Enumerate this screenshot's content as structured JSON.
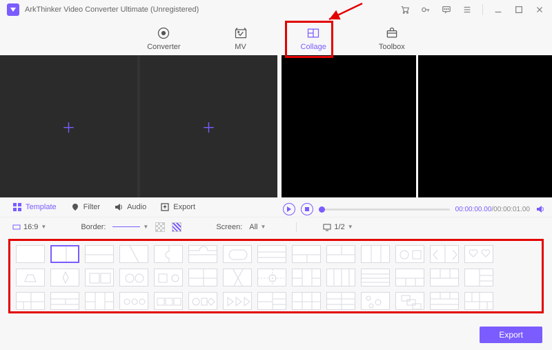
{
  "app": {
    "title": "ArkThinker Video Converter Ultimate (Unregistered)"
  },
  "nav": {
    "items": [
      {
        "label": "Converter"
      },
      {
        "label": "MV"
      },
      {
        "label": "Collage"
      },
      {
        "label": "Toolbox"
      }
    ],
    "active_index": 2
  },
  "tabs": {
    "items": [
      {
        "label": "Template"
      },
      {
        "label": "Filter"
      },
      {
        "label": "Audio"
      },
      {
        "label": "Export"
      }
    ],
    "active_index": 0
  },
  "player": {
    "current": "00:00:00.00",
    "total": "00:00:01.00"
  },
  "options": {
    "ratio": "16:9",
    "border_label": "Border:",
    "screen_label": "Screen:",
    "screen_value": "All",
    "preview_scale": "1/2"
  },
  "footer": {
    "export_label": "Export"
  },
  "colors": {
    "accent": "#7b5cff",
    "highlight": "#e30000"
  }
}
